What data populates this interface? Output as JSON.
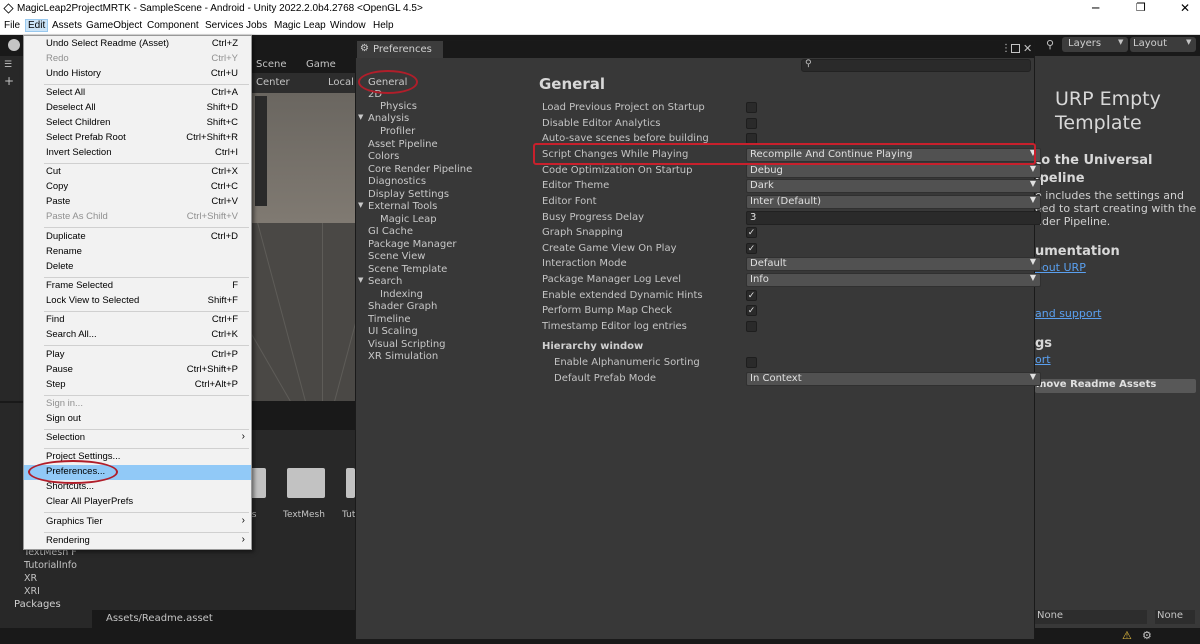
{
  "window": {
    "title": "MagicLeap2ProjectMRTK - SampleScene - Android - Unity 2022.2.0b4.2768 <OpenGL 4.5>"
  },
  "menubar": {
    "items": [
      "File",
      "Edit",
      "Assets",
      "GameObject",
      "Component",
      "Services",
      "Jobs",
      "Magic Leap",
      "Window",
      "Help"
    ]
  },
  "toolbar": {
    "layers": "Layers",
    "layout": "Layout"
  },
  "scene": {
    "tab_scene": "Scene",
    "tab_game": "Game",
    "pivot": "Center",
    "space": "Local"
  },
  "edit_menu": {
    "items": [
      {
        "label": "Undo Select Readme (Asset)",
        "shortcut": "Ctrl+Z"
      },
      {
        "label": "Redo",
        "shortcut": "Ctrl+Y"
      },
      {
        "label": "Undo History",
        "shortcut": "Ctrl+U"
      },
      {
        "label": "Select All",
        "shortcut": "Ctrl+A"
      },
      {
        "label": "Deselect All",
        "shortcut": "Shift+D"
      },
      {
        "label": "Select Children",
        "shortcut": "Shift+C"
      },
      {
        "label": "Select Prefab Root",
        "shortcut": "Ctrl+Shift+R"
      },
      {
        "label": "Invert Selection",
        "shortcut": "Ctrl+I"
      },
      {
        "label": "Cut",
        "shortcut": "Ctrl+X"
      },
      {
        "label": "Copy",
        "shortcut": "Ctrl+C"
      },
      {
        "label": "Paste",
        "shortcut": "Ctrl+V"
      },
      {
        "label": "Paste As Child",
        "shortcut": "Ctrl+Shift+V"
      },
      {
        "label": "Duplicate",
        "shortcut": "Ctrl+D"
      },
      {
        "label": "Rename",
        "shortcut": ""
      },
      {
        "label": "Delete",
        "shortcut": ""
      },
      {
        "label": "Frame Selected",
        "shortcut": "F"
      },
      {
        "label": "Lock View to Selected",
        "shortcut": "Shift+F"
      },
      {
        "label": "Find",
        "shortcut": "Ctrl+F"
      },
      {
        "label": "Search All...",
        "shortcut": "Ctrl+K"
      },
      {
        "label": "Play",
        "shortcut": "Ctrl+P"
      },
      {
        "label": "Pause",
        "shortcut": "Ctrl+Shift+P"
      },
      {
        "label": "Step",
        "shortcut": "Ctrl+Alt+P"
      },
      {
        "label": "Sign in...",
        "shortcut": ""
      },
      {
        "label": "Sign out",
        "shortcut": ""
      },
      {
        "label": "Selection",
        "shortcut": ""
      },
      {
        "label": "Project Settings...",
        "shortcut": ""
      },
      {
        "label": "Preferences...",
        "shortcut": ""
      },
      {
        "label": "Shortcuts...",
        "shortcut": ""
      },
      {
        "label": "Clear All PlayerPrefs",
        "shortcut": ""
      },
      {
        "label": "Graphics Tier",
        "shortcut": ""
      },
      {
        "label": "Rendering",
        "shortcut": ""
      }
    ]
  },
  "preferences": {
    "tab_title": "Preferences",
    "nav": [
      "General",
      "2D",
      "Physics",
      "Analysis",
      "Profiler",
      "Asset Pipeline",
      "Colors",
      "Core Render Pipeline",
      "Diagnostics",
      "Display Settings",
      "External Tools",
      "Magic Leap",
      "GI Cache",
      "Package Manager",
      "Scene View",
      "Scene Template",
      "Search",
      "Indexing",
      "Shader Graph",
      "Timeline",
      "UI Scaling",
      "Visual Scripting",
      "XR Simulation"
    ],
    "heading": "General",
    "settings": [
      {
        "label": "Load Previous Project on Startup",
        "value": ""
      },
      {
        "label": "Disable Editor Analytics",
        "value": ""
      },
      {
        "label": "Auto-save scenes before building",
        "value": ""
      },
      {
        "label": "Script Changes While Playing",
        "value": "Recompile And Continue Playing"
      },
      {
        "label": "Code Optimization On Startup",
        "value": "Debug"
      },
      {
        "label": "Editor Theme",
        "value": "Dark"
      },
      {
        "label": "Editor Font",
        "value": "Inter (Default)"
      },
      {
        "label": "Busy Progress Delay",
        "value": "3"
      },
      {
        "label": "Graph Snapping",
        "value": "✓"
      },
      {
        "label": "Create Game View On Play",
        "value": "✓"
      },
      {
        "label": "Interaction Mode",
        "value": "Default"
      },
      {
        "label": "Package Manager Log Level",
        "value": "Info"
      },
      {
        "label": "Enable extended Dynamic Hints",
        "value": "✓"
      },
      {
        "label": "Perform Bump Map Check",
        "value": "✓"
      },
      {
        "label": "Timestamp Editor log entries",
        "value": ""
      }
    ],
    "hierarchy_heading": "Hierarchy window",
    "hierarchy_settings": [
      {
        "label": "Enable Alphanumeric Sorting",
        "value": ""
      },
      {
        "label": "Default Prefab Mode",
        "value": "In Context"
      }
    ]
  },
  "inspector": {
    "title_line1": "URP Empty",
    "title_line2": "Template",
    "h1a": "to the Universal",
    "h1b": "ipeline",
    "p1": "e includes the settings and",
    "p2": "eed to start creating with the",
    "p3": "nder Pipeline.",
    "h2": "umentation",
    "link1": "bout URP",
    "link2": " and support",
    "h3": "gs",
    "link3": "ort",
    "button": "move Readme Assets"
  },
  "project": {
    "items": [
      "TextMesh F",
      "TutorialInfo",
      "XR",
      "XRI",
      "Packages"
    ],
    "assets": [
      "gs",
      "TextMesh",
      "Tut"
    ],
    "path": "Assets/Readme.asset"
  },
  "statusbar": {
    "none1": "None",
    "none2": "None"
  }
}
